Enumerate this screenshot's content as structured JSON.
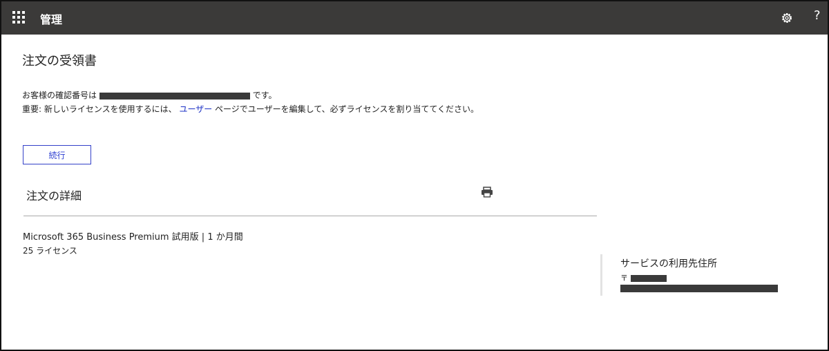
{
  "header": {
    "app_title": "管理",
    "waffle_icon": "app-launcher-icon",
    "settings_icon": "gear-icon",
    "help_label": "?"
  },
  "receipt": {
    "title": "注文の受領書",
    "confirmation_prefix": "お客様の確認番号は",
    "confirmation_suffix": "です。",
    "important_prefix": "重要: 新しいライセンスを使用するには、",
    "users_link": "ユーザー",
    "important_suffix": "ページでユーザーを編集して、必ずライセンスを割り当ててください。",
    "continue_label": "続行"
  },
  "order_details": {
    "title": "注文の詳細",
    "print_icon": "print-icon",
    "product": "Microsoft 365 Business Premium 試用版 | 1 か月間",
    "licenses": "25 ライセンス"
  },
  "service_address": {
    "title": "サービスの利用先住所",
    "postal_mark": "〒"
  },
  "colors": {
    "topbar": "#3b3a39",
    "link": "#1a2fc4",
    "button_border": "#3340c8"
  }
}
